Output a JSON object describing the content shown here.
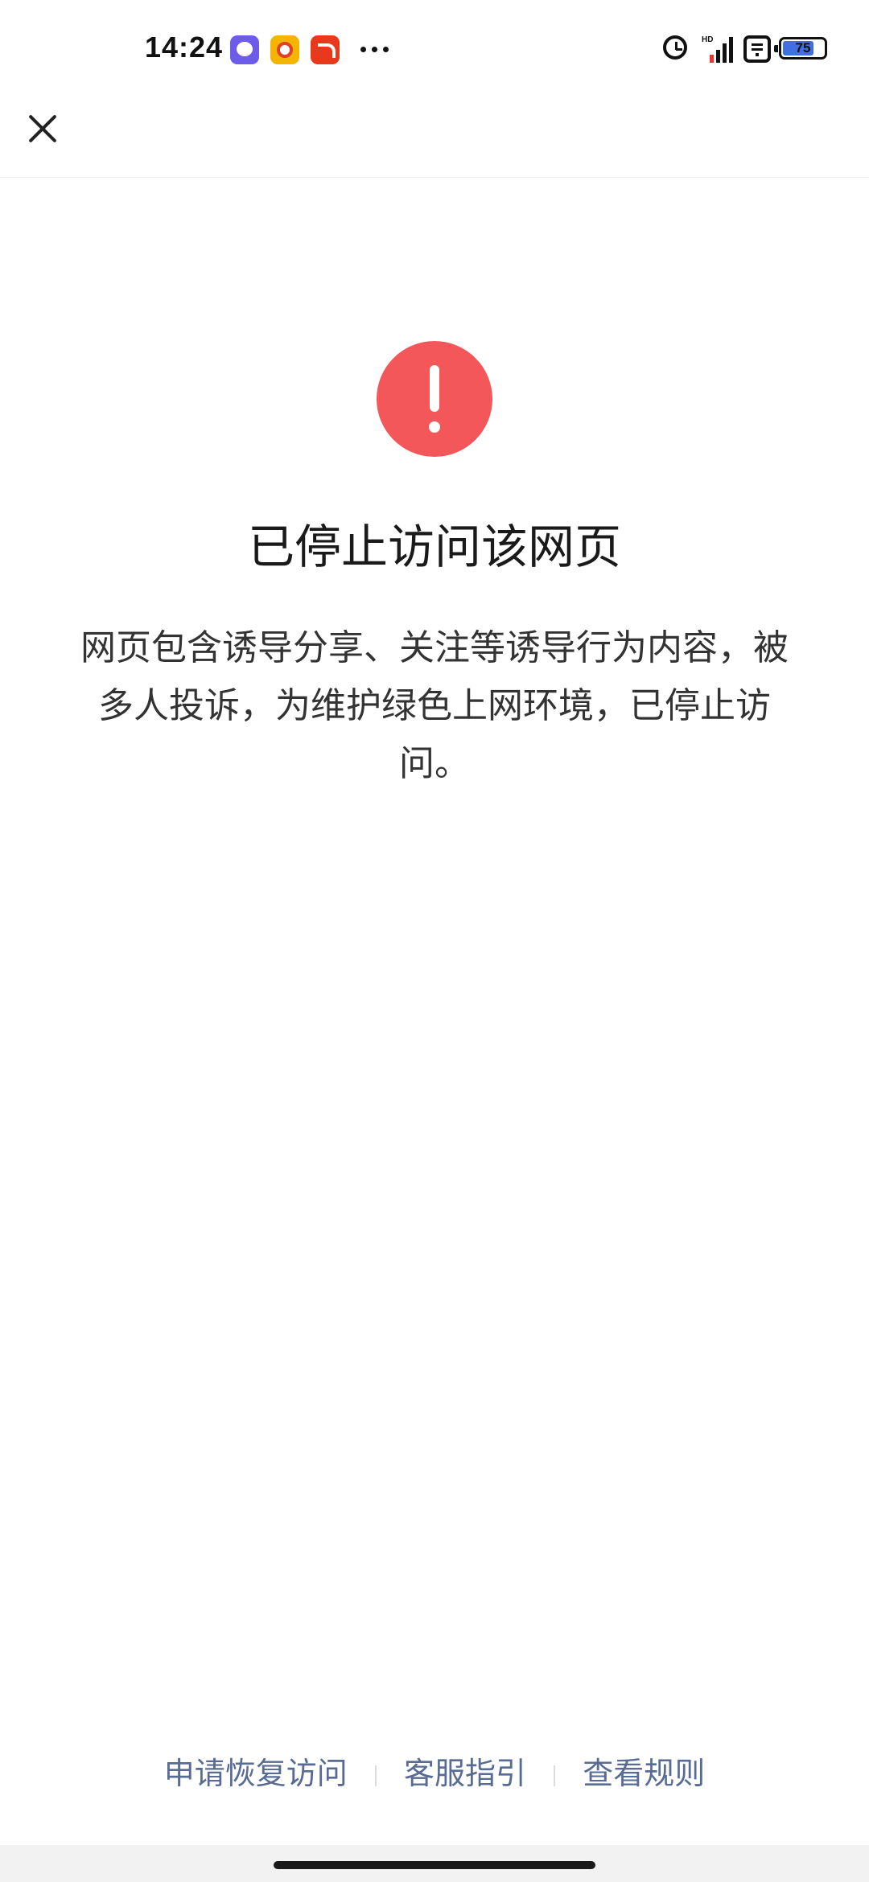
{
  "status_bar": {
    "time": "14:24",
    "battery_level": "75",
    "battery_fraction": 0.75,
    "network_label": "HD",
    "notification_icons": [
      "message-app-icon",
      "video-app-icon",
      "shopping-app-icon"
    ],
    "status_icons": [
      "alarm-icon",
      "signal-icon",
      "wifi-icon",
      "battery-icon"
    ]
  },
  "nav": {
    "close_icon": "close-icon"
  },
  "main": {
    "alert_icon": "exclamation-circle-icon",
    "alert_color": "#f4575a",
    "title": "已停止访问该网页",
    "description": "网页包含诱导分享、关注等诱导行为内容，被多人投诉，为维护绿色上网环境，已停止访问。"
  },
  "footer": {
    "links": [
      {
        "label": "申请恢复访问"
      },
      {
        "label": "客服指引"
      },
      {
        "label": "查看规则"
      }
    ],
    "link_color": "#576b95"
  }
}
